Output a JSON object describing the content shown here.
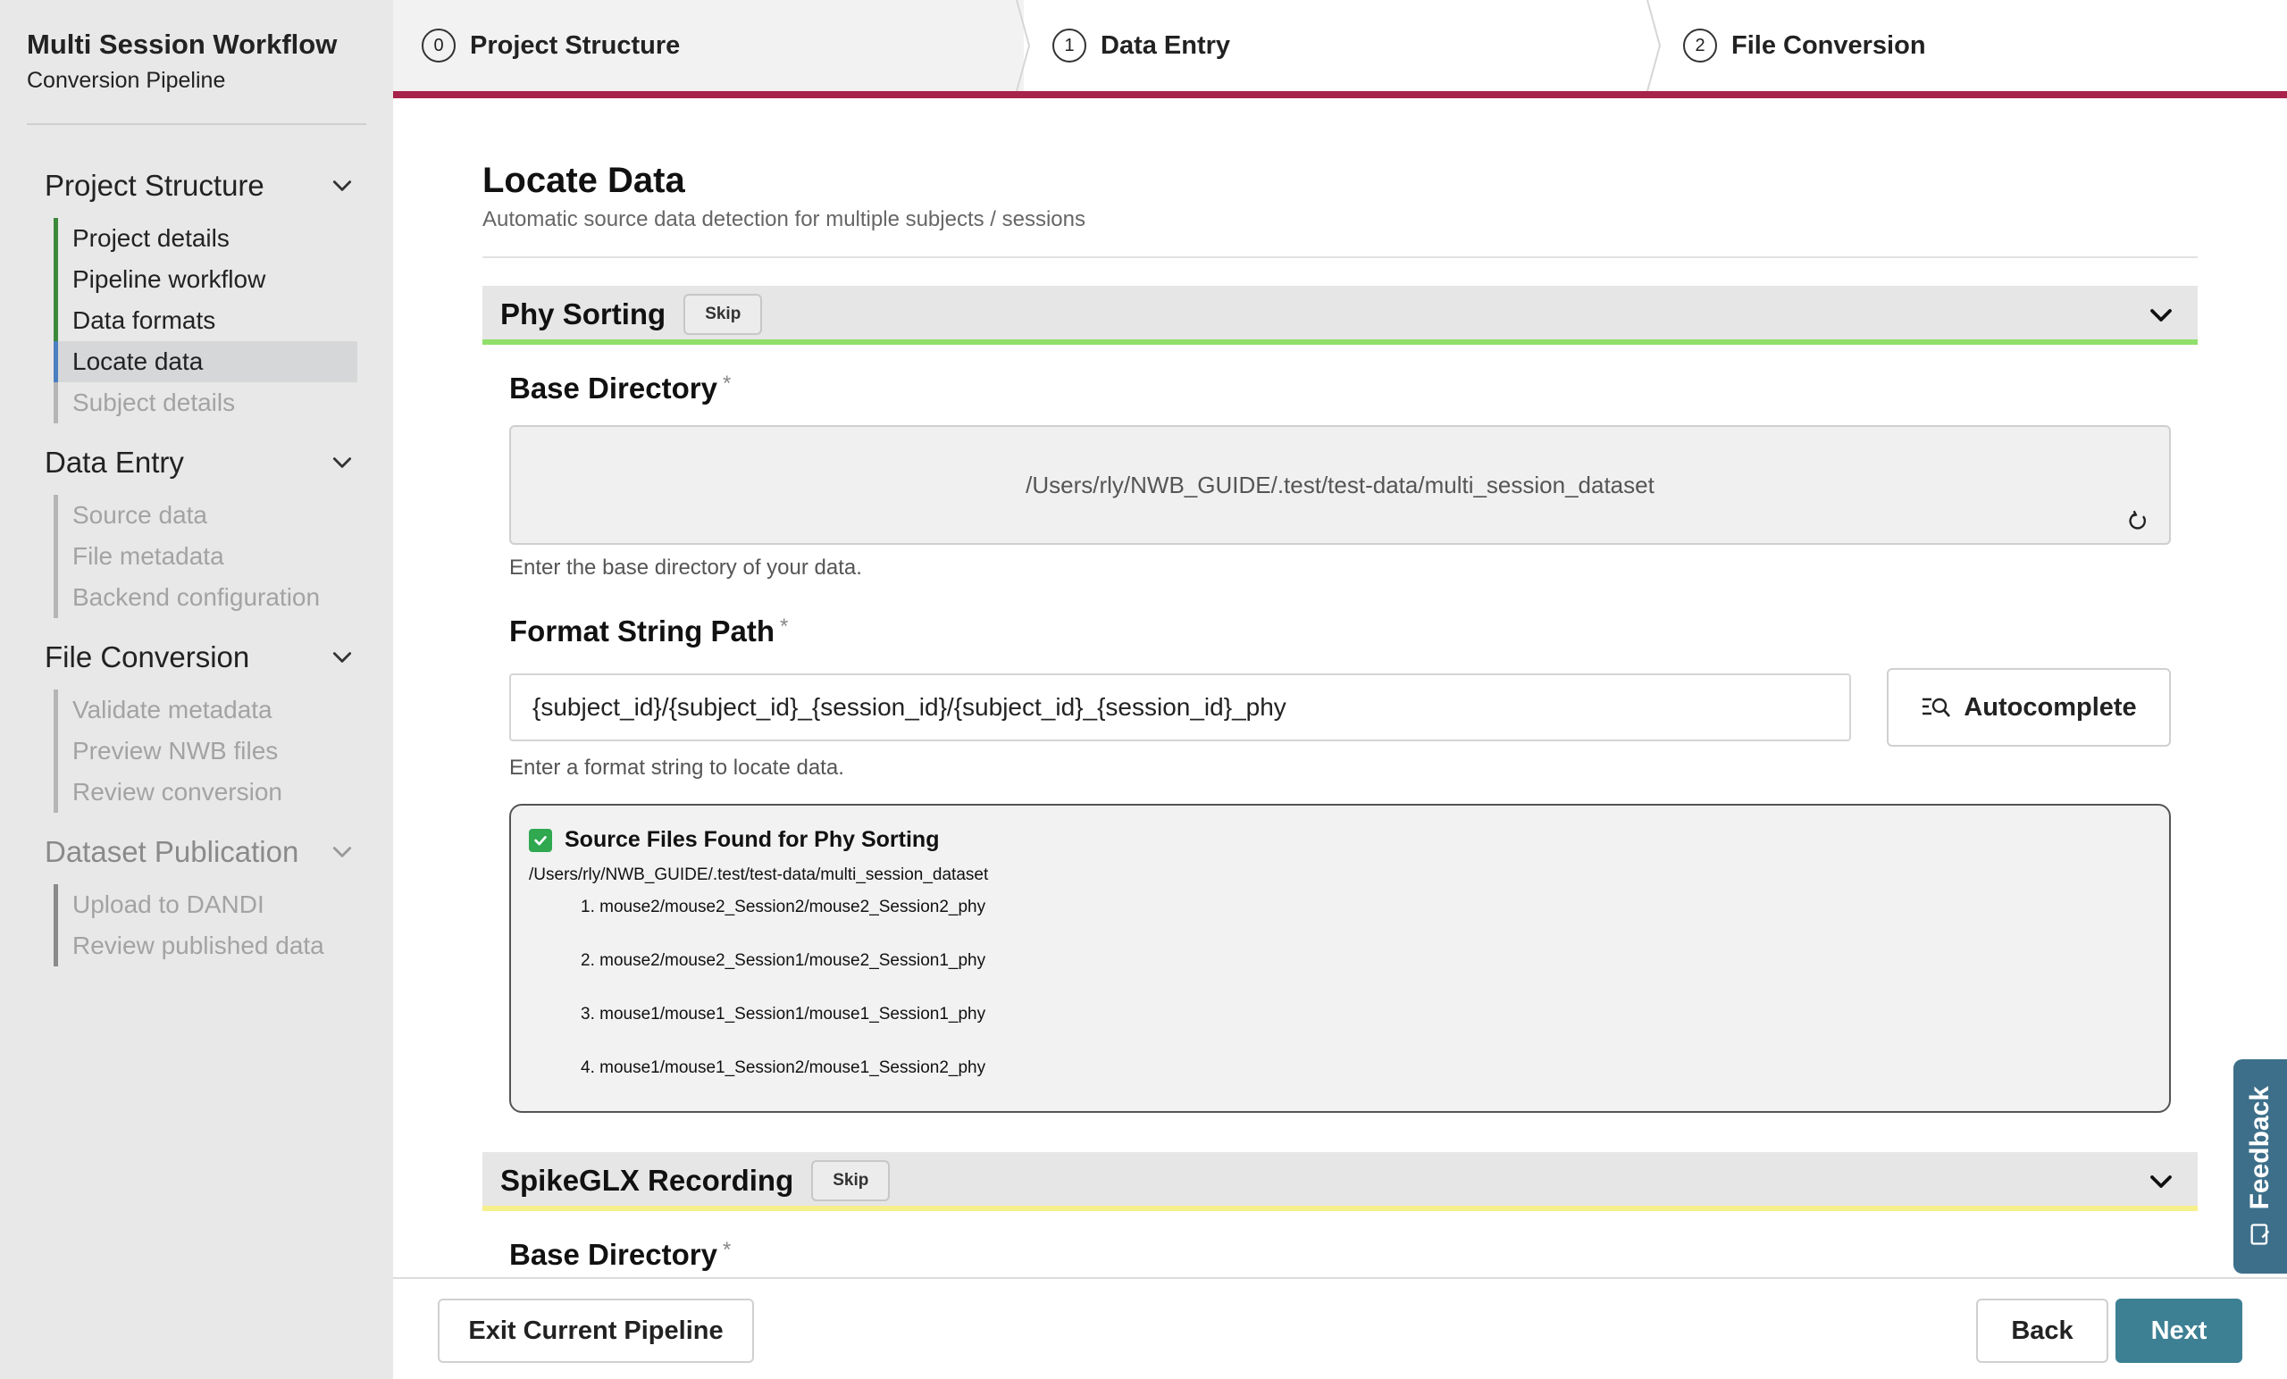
{
  "app": {
    "title": "Multi Session Workflow",
    "subtitle": "Conversion Pipeline"
  },
  "sidebar": {
    "sections": [
      {
        "label": "Project Structure",
        "items": [
          "Project details",
          "Pipeline workflow",
          "Data formats",
          "Locate data",
          "Subject details"
        ]
      },
      {
        "label": "Data Entry",
        "items": [
          "Source data",
          "File metadata",
          "Backend configuration"
        ]
      },
      {
        "label": "File Conversion",
        "items": [
          "Validate metadata",
          "Preview NWB files",
          "Review conversion"
        ]
      },
      {
        "label": "Dataset Publication",
        "items": [
          "Upload to DANDI",
          "Review published data"
        ]
      }
    ]
  },
  "stepper": {
    "steps": [
      {
        "num": "0",
        "label": "Project Structure"
      },
      {
        "num": "1",
        "label": "Data Entry"
      },
      {
        "num": "2",
        "label": "File Conversion"
      }
    ]
  },
  "page": {
    "title": "Locate Data",
    "subtitle": "Automatic source data detection for multiple subjects / sessions"
  },
  "phy": {
    "title": "Phy Sorting",
    "skip": "Skip",
    "base_dir_label": "Base Directory",
    "required": "*",
    "base_dir_value": "/Users/rly/NWB_GUIDE/.test/test-data/multi_session_dataset",
    "base_dir_help": "Enter the base directory of your data.",
    "format_label": "Format String Path",
    "format_value": "{subject_id}/{subject_id}_{session_id}/{subject_id}_{session_id}_phy",
    "format_help": "Enter a format string to locate data.",
    "autocomplete": "Autocomplete",
    "found_title": "Source Files Found for Phy Sorting",
    "found_root": "/Users/rly/NWB_GUIDE/.test/test-data/multi_session_dataset",
    "found_files": [
      "1. mouse2/mouse2_Session2/mouse2_Session2_phy",
      "2. mouse2/mouse2_Session1/mouse2_Session1_phy",
      "3. mouse1/mouse1_Session1/mouse1_Session1_phy",
      "4. mouse1/mouse1_Session2/mouse1_Session2_phy"
    ]
  },
  "spikeglx": {
    "title": "SpikeGLX Recording",
    "skip": "Skip",
    "base_dir_label": "Base Directory",
    "required": "*"
  },
  "footer": {
    "exit": "Exit Current Pipeline",
    "back": "Back",
    "next": "Next"
  },
  "feedback": {
    "label": "Feedback"
  },
  "colors": {
    "accent_bar": "#a8234a",
    "phy_underline": "#8fe06a",
    "spikeglx_underline": "#f5ef8c",
    "primary_button": "#3d8094",
    "feedback_tab": "#3d6f8a",
    "nav_done": "#3b8a3b",
    "nav_active": "#4a7fc1"
  }
}
